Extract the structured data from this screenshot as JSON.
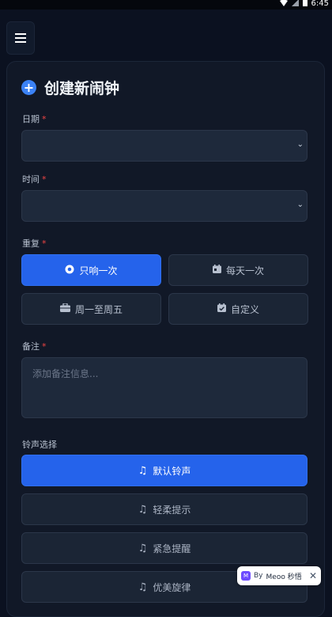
{
  "status": {
    "time": "6:45"
  },
  "header": {
    "menu_icon": "hamburger-menu-icon"
  },
  "form": {
    "title": "创建新闹钟",
    "date_label": "日期",
    "time_label": "时间",
    "required_mark": "*",
    "repeat_label": "重复",
    "repeat_options": [
      {
        "label": "只响一次",
        "icon": "radio-dot-icon",
        "selected": true
      },
      {
        "label": "每天一次",
        "icon": "calendar-icon",
        "selected": false
      },
      {
        "label": "周一至周五",
        "icon": "briefcase-icon",
        "selected": false
      },
      {
        "label": "自定义",
        "icon": "calendar-check-icon",
        "selected": false
      }
    ],
    "note_label": "备注",
    "note_placeholder": "添加备注信息...",
    "ringtone_label": "铃声选择",
    "ringtones": [
      {
        "label": "默认铃声",
        "selected": true
      },
      {
        "label": "轻柔提示",
        "selected": false
      },
      {
        "label": "紧急提醒",
        "selected": false
      },
      {
        "label": "优美旋律",
        "selected": false
      }
    ]
  },
  "badge": {
    "prefix": "By",
    "brand": "Meoo 秒悟"
  },
  "colors": {
    "accent": "#2563eb",
    "background": "#0b1120",
    "required": "#ef4444"
  }
}
